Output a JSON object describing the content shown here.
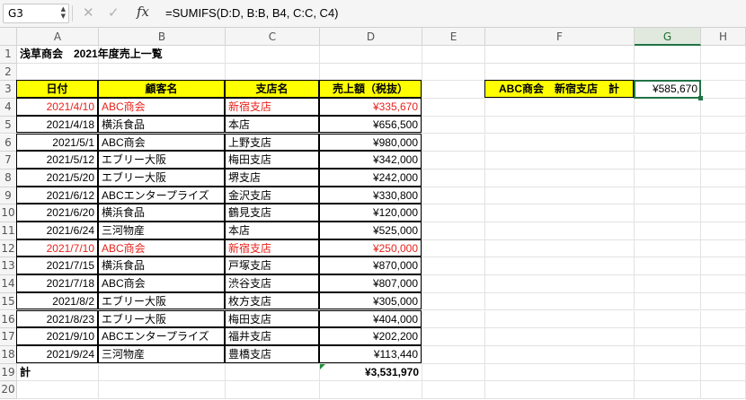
{
  "formula_bar": {
    "cell_ref": "G3",
    "formula": "=SUMIFS(D:D, B:B, B4, C:C, C4)",
    "fx_label": "fx"
  },
  "columns": [
    "A",
    "B",
    "C",
    "D",
    "E",
    "F",
    "G",
    "H"
  ],
  "rows": [
    "1",
    "2",
    "3",
    "4",
    "5",
    "6",
    "7",
    "8",
    "9",
    "10",
    "11",
    "12",
    "13",
    "14",
    "15",
    "16",
    "17",
    "18",
    "19",
    "20"
  ],
  "title": "浅草商会　2021年度売上一覧",
  "table": {
    "headers": [
      "日付",
      "顧客名",
      "支店名",
      "売上額（税抜）"
    ],
    "records": [
      {
        "date": "2021/4/10",
        "customer": "ABC商会",
        "branch": "新宿支店",
        "amount": "¥335,670",
        "highlight": true
      },
      {
        "date": "2021/4/18",
        "customer": "横浜食品",
        "branch": "本店",
        "amount": "¥656,500",
        "highlight": false
      },
      {
        "date": "2021/5/1",
        "customer": "ABC商会",
        "branch": "上野支店",
        "amount": "¥980,000",
        "highlight": false
      },
      {
        "date": "2021/5/12",
        "customer": "エブリー大阪",
        "branch": "梅田支店",
        "amount": "¥342,000",
        "highlight": false
      },
      {
        "date": "2021/5/20",
        "customer": "エブリー大阪",
        "branch": "堺支店",
        "amount": "¥242,000",
        "highlight": false
      },
      {
        "date": "2021/6/12",
        "customer": "ABCエンタープライズ",
        "branch": "金沢支店",
        "amount": "¥330,800",
        "highlight": false
      },
      {
        "date": "2021/6/20",
        "customer": "横浜食品",
        "branch": "鶴見支店",
        "amount": "¥120,000",
        "highlight": false
      },
      {
        "date": "2021/6/24",
        "customer": "三河物産",
        "branch": "本店",
        "amount": "¥525,000",
        "highlight": false
      },
      {
        "date": "2021/7/10",
        "customer": "ABC商会",
        "branch": "新宿支店",
        "amount": "¥250,000",
        "highlight": true
      },
      {
        "date": "2021/7/15",
        "customer": "横浜食品",
        "branch": "戸塚支店",
        "amount": "¥870,000",
        "highlight": false
      },
      {
        "date": "2021/7/18",
        "customer": "ABC商会",
        "branch": "渋谷支店",
        "amount": "¥807,000",
        "highlight": false
      },
      {
        "date": "2021/8/2",
        "customer": "エブリー大阪",
        "branch": "枚方支店",
        "amount": "¥305,000",
        "highlight": false
      },
      {
        "date": "2021/8/23",
        "customer": "エブリー大阪",
        "branch": "梅田支店",
        "amount": "¥404,000",
        "highlight": false
      },
      {
        "date": "2021/9/10",
        "customer": "ABCエンタープライズ",
        "branch": "福井支店",
        "amount": "¥202,200",
        "highlight": false
      },
      {
        "date": "2021/9/24",
        "customer": "三河物産",
        "branch": "豊橋支店",
        "amount": "¥113,440",
        "highlight": false
      }
    ],
    "total_label": "計",
    "total_value": "¥3,531,970"
  },
  "summary": {
    "label": "ABC商会　新宿支店　計",
    "value": "¥585,670"
  },
  "colors": {
    "header_fill": "#ffff00",
    "highlight_text": "#e8221b",
    "selection": "#217346"
  }
}
